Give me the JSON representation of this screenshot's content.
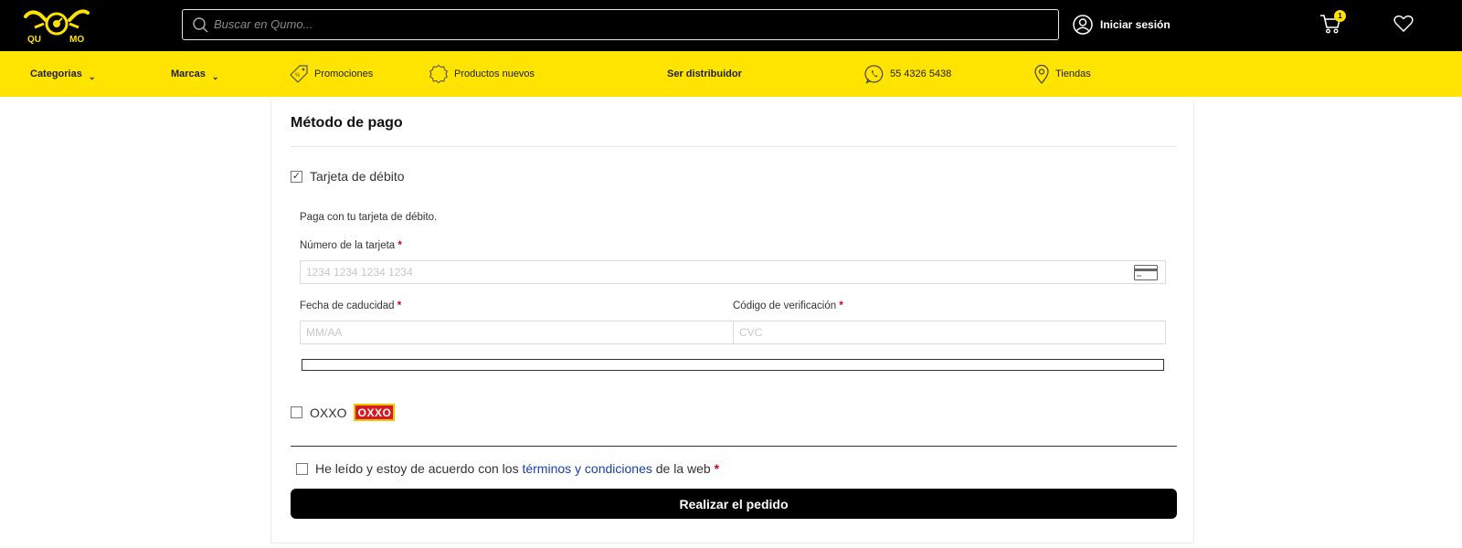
{
  "header": {
    "logo_text_left": "QU",
    "logo_text_right": "MO",
    "search_placeholder": "Buscar en Qumo...",
    "login_label": "Iniciar sesión",
    "cart_count": "1",
    "icons": [
      "search-icon",
      "user-icon",
      "cart-icon",
      "heart-icon"
    ],
    "colors": {
      "header_bg": "#000000",
      "nav_bg": "#ffe400",
      "accent": "#ffe200"
    }
  },
  "nav": {
    "categories": "Categorias",
    "brands": "Marcas",
    "promotions": "Promociones",
    "new_products": "Productos nuevos",
    "distributor": "Ser distribuidor",
    "phone": "55 4326 5438",
    "stores": "Tiendas"
  },
  "payment": {
    "title": "Método de pago",
    "debit_label": "Tarjeta de débito",
    "debit_checked": true,
    "debit_description": "Paga con tu tarjeta de débito.",
    "card_number_label": "Número de la tarjeta",
    "card_number_placeholder": "1234 1234 1234 1234",
    "expiry_label": "Fecha de caducidad",
    "expiry_placeholder": "MM/AA",
    "cvc_label": "Código de verificación",
    "cvc_placeholder": "CVC",
    "required_mark": "*",
    "oxxo_label": "OXXO",
    "oxxo_logo_text": "OXXO",
    "oxxo_checked": false
  },
  "terms": {
    "prefix": "He leído y estoy de acuerdo con los",
    "link": "términos y condiciones",
    "suffix": "de la web",
    "required_mark": "*"
  },
  "order_button": "Realizar el pedido"
}
